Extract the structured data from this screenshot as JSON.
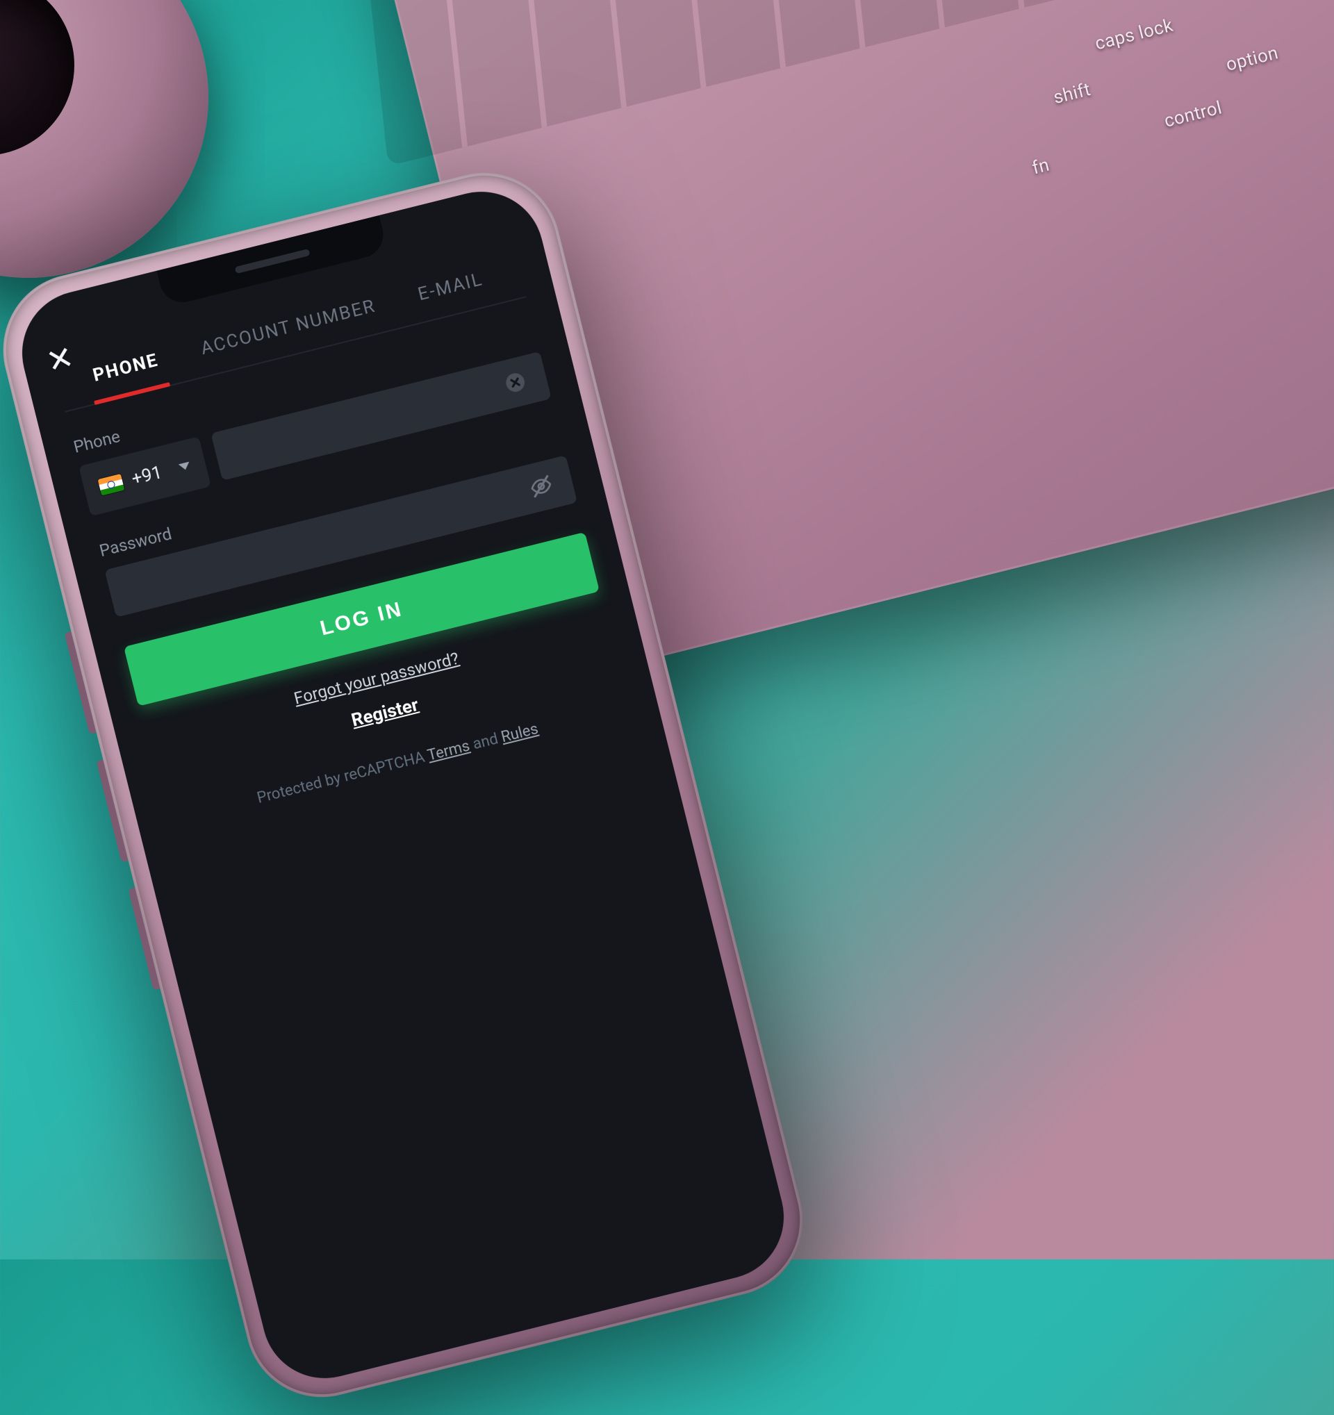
{
  "decor": {
    "keyboard_keys": [
      "caps lock",
      "option",
      "shift",
      "control",
      "fn"
    ]
  },
  "app": {
    "close_label": "✕",
    "tabs": [
      {
        "id": "phone",
        "label": "PHONE",
        "active": true
      },
      {
        "id": "account",
        "label": "ACCOUNT NUMBER",
        "active": false
      },
      {
        "id": "email",
        "label": "E-MAIL",
        "active": false
      }
    ],
    "phone_field": {
      "label": "Phone",
      "country_code": "+91",
      "flag_name": "india-flag-icon",
      "value": "",
      "placeholder": "",
      "clear_icon": "clear-icon"
    },
    "password_field": {
      "label": "Password",
      "value": "",
      "placeholder": "",
      "toggle_icon": "eye-off-icon"
    },
    "login_button": "LOG IN",
    "forgot_link": "Forgot your password?",
    "register_link": "Register",
    "legal": {
      "prefix": "Protected by reCAPTCHA ",
      "terms": "Terms",
      "and": " and ",
      "rules": "Rules"
    }
  }
}
